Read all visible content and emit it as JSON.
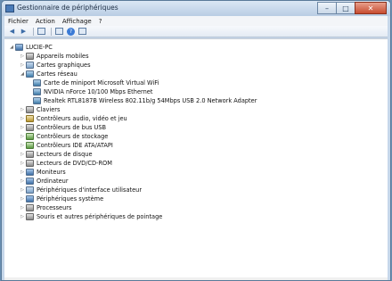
{
  "window": {
    "title": "Gestionnaire de périphériques",
    "min": "–",
    "max": "□",
    "close": "✕"
  },
  "menu": [
    "Fichier",
    "Action",
    "Affichage",
    "?"
  ],
  "toolbar": {
    "back": "◀",
    "forward": "▶",
    "help": "?"
  },
  "tree": {
    "root": "LUCIE-PC",
    "items": [
      {
        "label": "Appareils mobiles",
        "level": 1,
        "expanded": false,
        "icon": "mobile-device-icon"
      },
      {
        "label": "Cartes graphiques",
        "level": 1,
        "expanded": false,
        "icon": "display-adapter-icon"
      },
      {
        "label": "Cartes réseau",
        "level": 1,
        "expanded": true,
        "icon": "network-adapter-icon"
      },
      {
        "label": "Carte de miniport Microsoft Virtual WiFi",
        "level": 2,
        "icon": "network-adapter-icon"
      },
      {
        "label": "NVIDIA nForce 10/100 Mbps Ethernet",
        "level": 2,
        "icon": "network-adapter-icon"
      },
      {
        "label": "Realtek RTL8187B Wireless 802.11b/g 54Mbps USB 2.0 Network Adapter",
        "level": 2,
        "icon": "network-adapter-icon"
      },
      {
        "label": "Claviers",
        "level": 1,
        "expanded": false,
        "icon": "keyboard-icon"
      },
      {
        "label": "Contrôleurs audio, vidéo et jeu",
        "level": 1,
        "expanded": false,
        "icon": "audio-icon"
      },
      {
        "label": "Contrôleurs de bus USB",
        "level": 1,
        "expanded": false,
        "icon": "usb-icon"
      },
      {
        "label": "Contrôleurs de stockage",
        "level": 1,
        "expanded": false,
        "icon": "storage-icon"
      },
      {
        "label": "Contrôleurs IDE ATA/ATAPI",
        "level": 1,
        "expanded": false,
        "icon": "ide-icon"
      },
      {
        "label": "Lecteurs de disque",
        "level": 1,
        "expanded": false,
        "icon": "disk-drive-icon"
      },
      {
        "label": "Lecteurs de DVD/CD-ROM",
        "level": 1,
        "expanded": false,
        "icon": "dvd-icon"
      },
      {
        "label": "Moniteurs",
        "level": 1,
        "expanded": false,
        "icon": "monitor-icon"
      },
      {
        "label": "Ordinateur",
        "level": 1,
        "expanded": false,
        "icon": "computer-icon"
      },
      {
        "label": "Périphériques d'interface utilisateur",
        "level": 1,
        "expanded": false,
        "icon": "hid-icon"
      },
      {
        "label": "Périphériques système",
        "level": 1,
        "expanded": false,
        "icon": "system-device-icon"
      },
      {
        "label": "Processeurs",
        "level": 1,
        "expanded": false,
        "icon": "processor-icon"
      },
      {
        "label": "Souris et autres périphériques de pointage",
        "level": 1,
        "expanded": false,
        "icon": "mouse-icon"
      }
    ]
  }
}
